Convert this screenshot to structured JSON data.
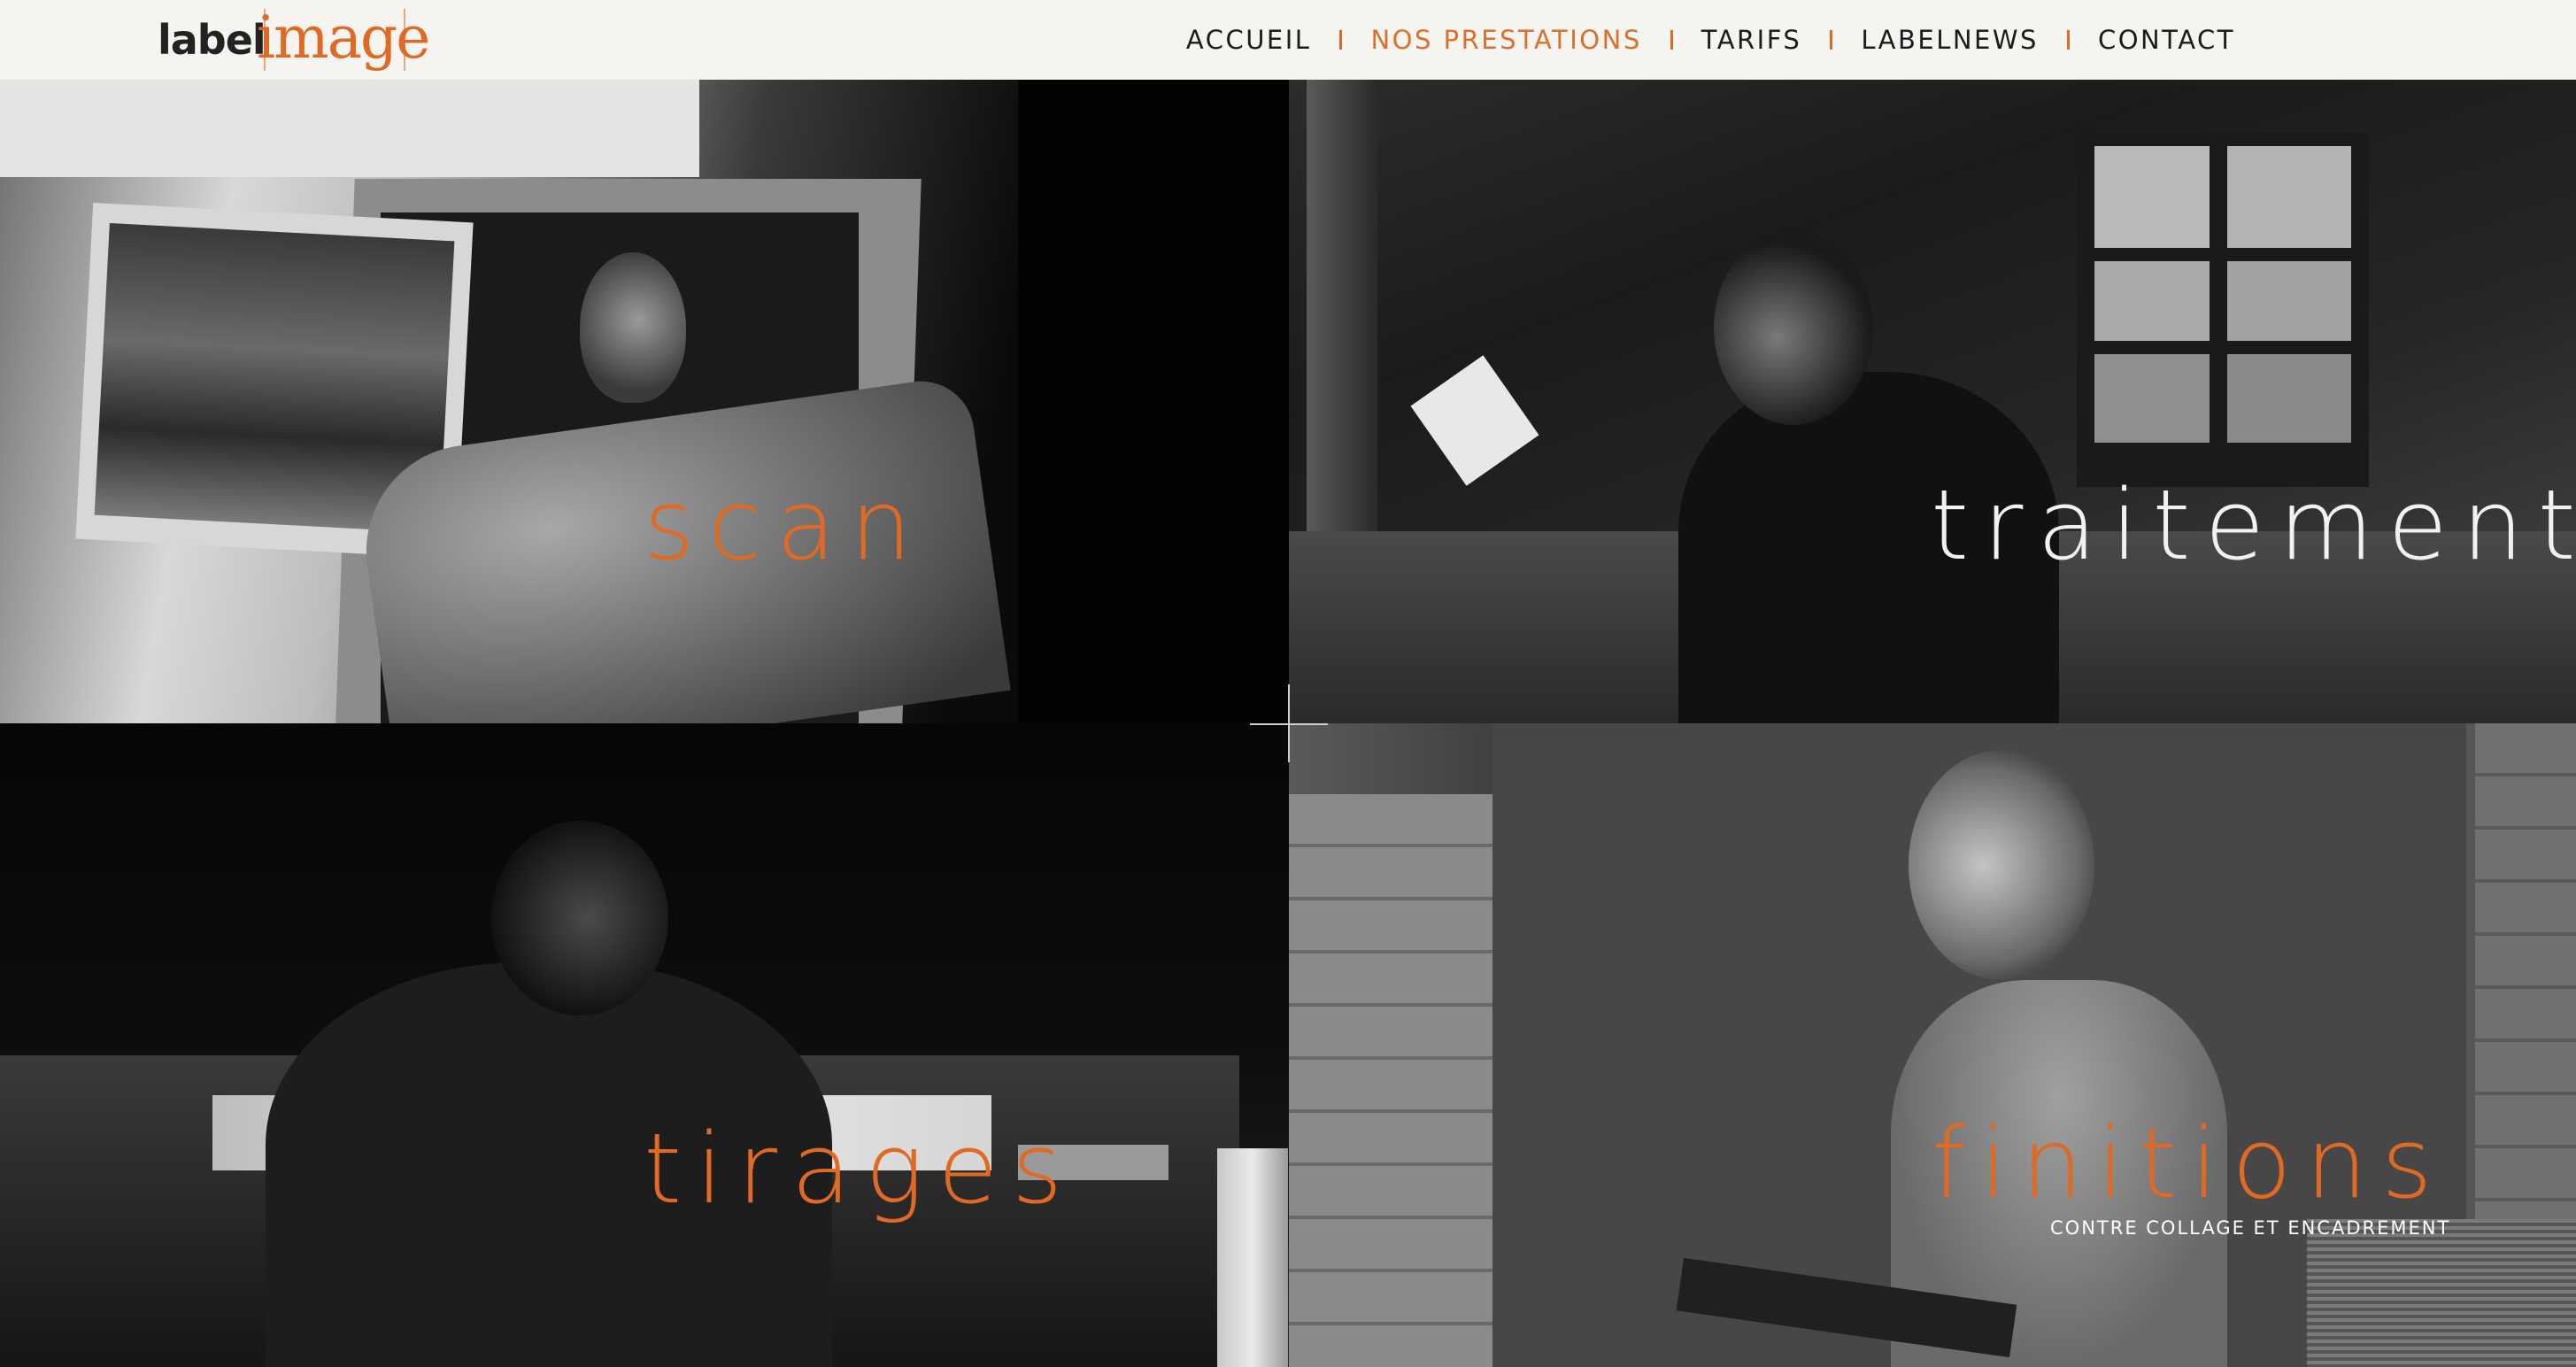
{
  "logo": {
    "part1": "label",
    "part2": "image"
  },
  "nav": {
    "items": [
      {
        "label": "ACCUEIL"
      },
      {
        "label": "NOS PRESTATIONS"
      },
      {
        "label": "TARIFS"
      },
      {
        "label": "LABELNEWS"
      },
      {
        "label": "CONTACT"
      }
    ],
    "active": "NOS PRESTATIONS"
  },
  "panels": {
    "scan": {
      "title": "scan"
    },
    "traitement": {
      "title": "traitement"
    },
    "tirages": {
      "title": "tirages"
    },
    "finitions": {
      "title": "finitions",
      "subtitle": "CONTRE COLLAGE ET ENCADREMENT"
    }
  },
  "colors": {
    "accent": "#e06a24",
    "header_bg": "#f6f4f1",
    "nav_text": "#1c1c1c"
  }
}
